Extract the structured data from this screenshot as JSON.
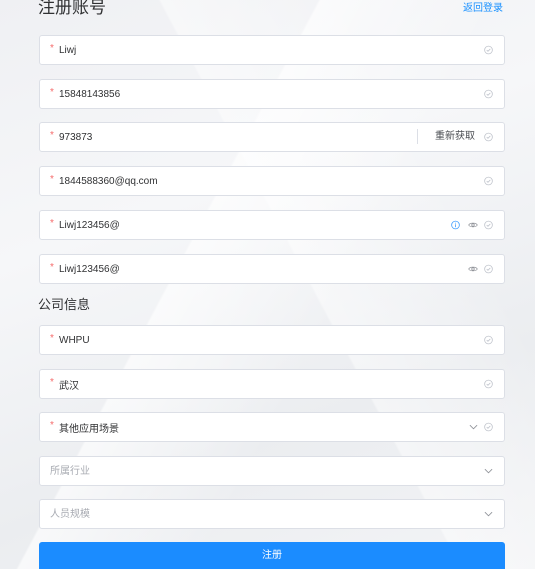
{
  "page": {
    "title": "注册账号",
    "back_to_login": "返回登录"
  },
  "required_mark": "*",
  "account": {
    "username": {
      "value": "Liwj"
    },
    "phone": {
      "value": "15848143856"
    },
    "verification_code": {
      "value": "973873",
      "resend_label": "重新获取"
    },
    "email": {
      "value": "1844588360@qq.com"
    },
    "password": {
      "value": "Liwj123456@"
    },
    "confirm_password": {
      "value": "Liwj123456@"
    }
  },
  "company_section": {
    "title": "公司信息"
  },
  "company": {
    "name": {
      "value": "WHPU"
    },
    "city": {
      "value": "武汉"
    },
    "scenario": {
      "value": "其他应用场景"
    },
    "industry": {
      "placeholder": "所属行业"
    },
    "size": {
      "placeholder": "人员规模"
    }
  },
  "submit": {
    "label": "注册"
  },
  "icons": {
    "valid": "check-circle-icon",
    "password_toggle": "eye-icon",
    "hint": "info-circle-icon",
    "dropdown": "chevron-down-icon"
  },
  "colors": {
    "accent": "#1890ff",
    "required": "#f56c6c",
    "border": "#dcdfe6",
    "icon": "#c0c4cc",
    "text": "#303133",
    "placeholder": "#a8abb2"
  }
}
